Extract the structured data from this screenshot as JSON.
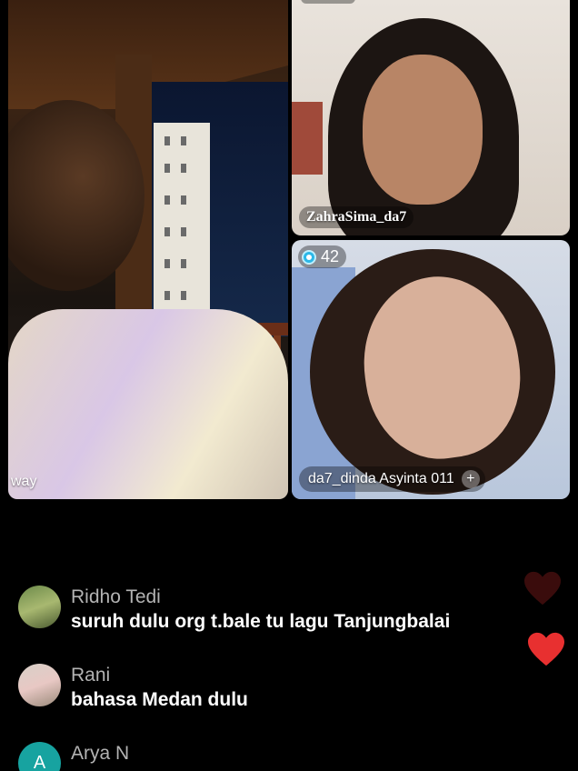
{
  "tiles": {
    "main": {
      "label": "way"
    },
    "top_right": {
      "username": "ZahraSima_da7"
    },
    "bottom_right": {
      "viewer_count": "42",
      "username": "da7_dinda Asyinta 011",
      "plus": "+"
    }
  },
  "comments": [
    {
      "name": "Ridho Tedi",
      "message": "suruh dulu org t.bale tu lagu Tanjungbalai",
      "avatar": "photo"
    },
    {
      "name": "Rani",
      "message": "bahasa Medan dulu",
      "avatar": "photo"
    },
    {
      "name": "Arya N",
      "message": "",
      "avatar_initial": "A"
    }
  ],
  "colors": {
    "background": "#000000",
    "heart_red": "#e83030",
    "comment_name": "#b3b3b3",
    "avatar_teal": "#17a3a0"
  },
  "icons": [
    "gem-icon",
    "plus-icon",
    "heart-icon"
  ]
}
